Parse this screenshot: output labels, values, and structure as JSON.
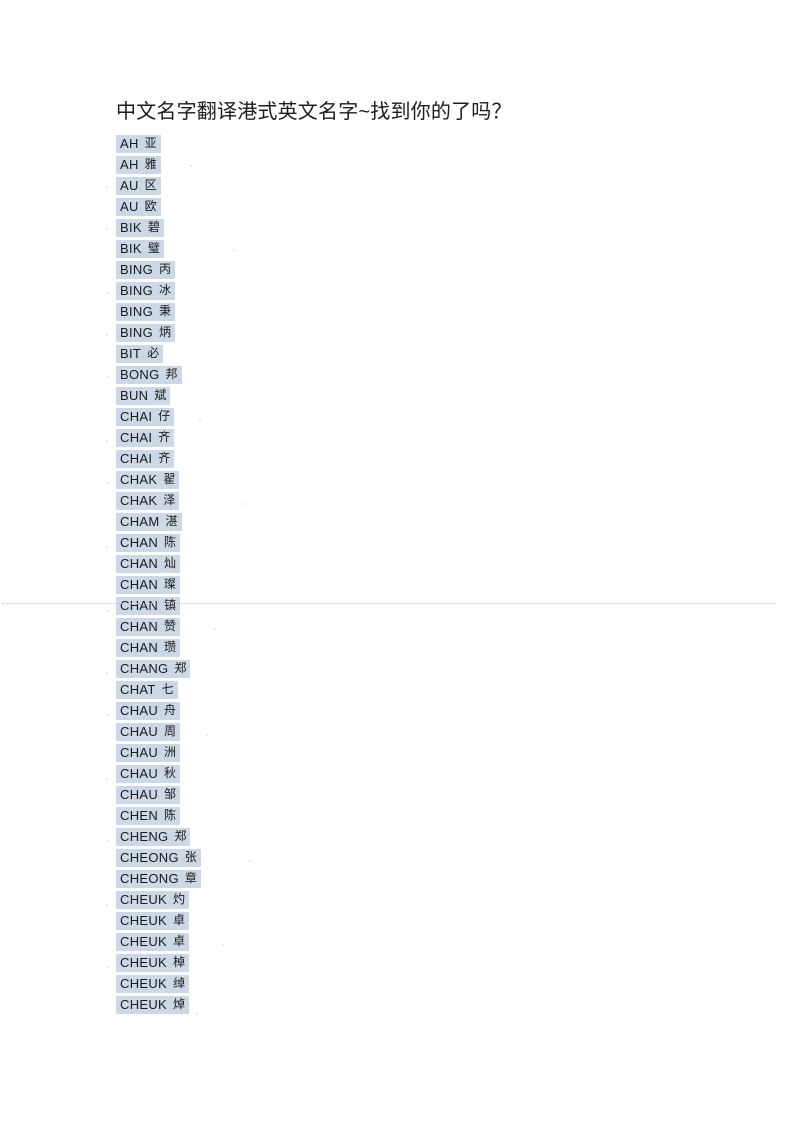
{
  "document": {
    "title": "中文名字翻译港式英文名字~找到你的了吗？"
  },
  "colors": {
    "page_background": "#ffffff",
    "text": "#1b1b1b",
    "highlight": "#ccd8e6",
    "rule": "#c9c9c9"
  },
  "page_break": {
    "style": "dotted"
  },
  "name_list": [
    {
      "romanization": "AH",
      "hanzi": "亚"
    },
    {
      "romanization": "AH",
      "hanzi": "雅"
    },
    {
      "romanization": "AU",
      "hanzi": "区"
    },
    {
      "romanization": "AU",
      "hanzi": "欧"
    },
    {
      "romanization": "BIK",
      "hanzi": "碧"
    },
    {
      "romanization": "BIK",
      "hanzi": "璧"
    },
    {
      "romanization": "BING",
      "hanzi": "丙"
    },
    {
      "romanization": "BING",
      "hanzi": "冰"
    },
    {
      "romanization": "BING",
      "hanzi": "秉"
    },
    {
      "romanization": "BING",
      "hanzi": "炳"
    },
    {
      "romanization": "BIT",
      "hanzi": "必"
    },
    {
      "romanization": "BONG",
      "hanzi": "邦"
    },
    {
      "romanization": "BUN",
      "hanzi": "斌"
    },
    {
      "romanization": "CHAI",
      "hanzi": "仔"
    },
    {
      "romanization": "CHAI",
      "hanzi": "齐"
    },
    {
      "romanization": "CHAI",
      "hanzi": "齐"
    },
    {
      "romanization": "CHAK",
      "hanzi": "翟"
    },
    {
      "romanization": "CHAK",
      "hanzi": "泽"
    },
    {
      "romanization": "CHAM",
      "hanzi": "湛"
    },
    {
      "romanization": "CHAN",
      "hanzi": "陈"
    },
    {
      "romanization": "CHAN",
      "hanzi": "灿"
    },
    {
      "romanization": "CHAN",
      "hanzi": "璨"
    },
    {
      "romanization": "CHAN",
      "hanzi": "镇"
    },
    {
      "romanization": "CHAN",
      "hanzi": "赞"
    },
    {
      "romanization": "CHAN",
      "hanzi": "瓒"
    },
    {
      "romanization": "CHANG",
      "hanzi": "郑"
    },
    {
      "romanization": "CHAT",
      "hanzi": "七"
    },
    {
      "romanization": "CHAU",
      "hanzi": "舟"
    },
    {
      "romanization": "CHAU",
      "hanzi": "周"
    },
    {
      "romanization": "CHAU",
      "hanzi": "洲"
    },
    {
      "romanization": "CHAU",
      "hanzi": "秋"
    },
    {
      "romanization": "CHAU",
      "hanzi": "邹"
    },
    {
      "romanization": "CHEN",
      "hanzi": "陈"
    },
    {
      "romanization": "CHENG",
      "hanzi": "郑"
    },
    {
      "romanization": "CHEONG",
      "hanzi": "张"
    },
    {
      "romanization": "CHEONG",
      "hanzi": "章"
    },
    {
      "romanization": "CHEUK",
      "hanzi": "灼"
    },
    {
      "romanization": "CHEUK",
      "hanzi": "卓"
    },
    {
      "romanization": "CHEUK",
      "hanzi": "卓"
    },
    {
      "romanization": "CHEUK",
      "hanzi": "棹"
    },
    {
      "romanization": "CHEUK",
      "hanzi": "绰"
    },
    {
      "romanization": "CHEUK",
      "hanzi": "焯"
    }
  ]
}
